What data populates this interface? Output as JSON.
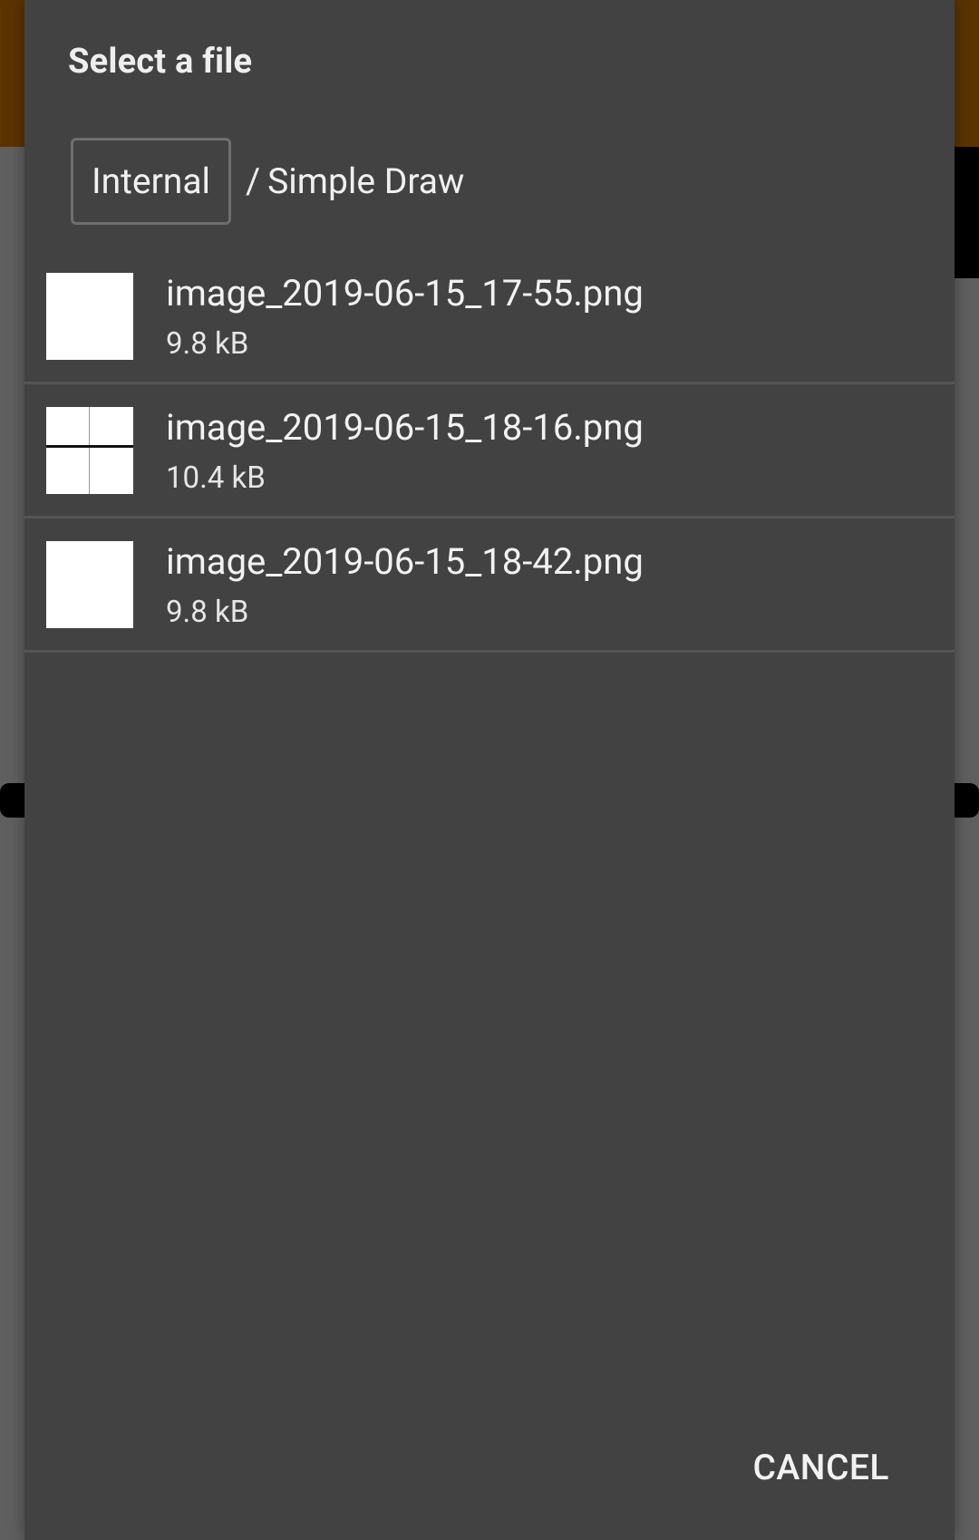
{
  "colors": {
    "dialog_background": "#424242",
    "background_toolbar": "#5a3300",
    "background_canvas": "#5f5f5f",
    "divider": "#555555",
    "text": "#f2f2f2"
  },
  "dialog": {
    "title": "Select a file",
    "path": {
      "root": "Internal",
      "separator": "/",
      "folder": "Simple Draw"
    },
    "files": [
      {
        "name": "image_2019-06-15_17-55.png",
        "size": "9.8 kB",
        "thumbnail": "blank-white-image"
      },
      {
        "name": "image_2019-06-15_18-16.png",
        "size": "10.4 kB",
        "thumbnail": "white-image-with-lines"
      },
      {
        "name": "image_2019-06-15_18-42.png",
        "size": "9.8 kB",
        "thumbnail": "blank-white-image"
      }
    ],
    "cancel_label": "CANCEL"
  }
}
